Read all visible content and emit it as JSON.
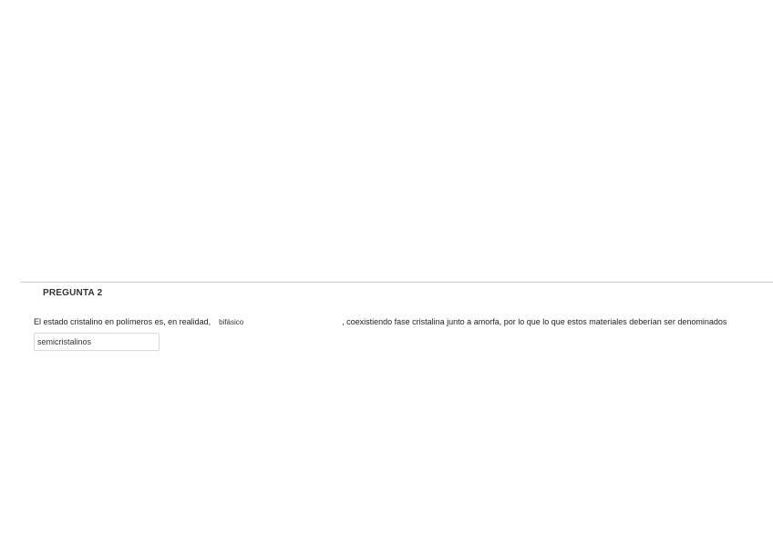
{
  "question": {
    "title": "PREGUNTA 2",
    "text_before": "El estado cristalino en polímeros es, en realidad,",
    "blank1_value": "bifásico",
    "text_after": ", coexistiendo fase cristalina junto a amorfa, por lo que lo que estos materiales deberían ser denominados",
    "blank2_value": "semicristalinos"
  }
}
